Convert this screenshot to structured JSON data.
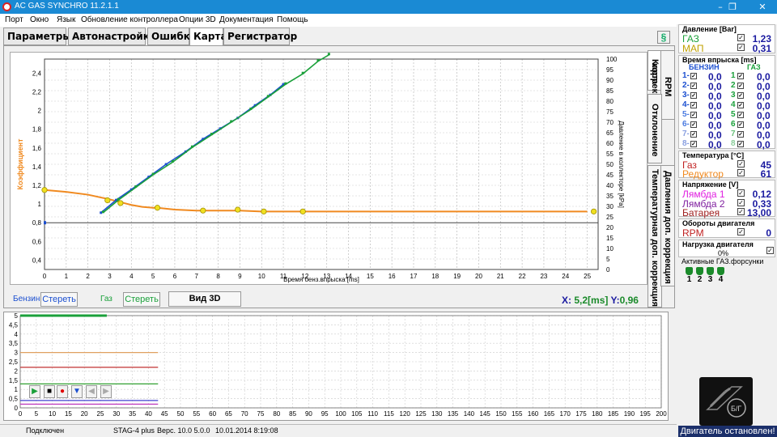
{
  "window": {
    "title": "AC GAS SYNCHRO  11.2.1.1",
    "minimize": "–",
    "maximize": "❐",
    "close": "✕"
  },
  "menu": [
    "Порт",
    "Окно",
    "Язык",
    "Обновление контроллера",
    "Опции 3D",
    "Документация",
    "Помощь"
  ],
  "tabs": [
    "Параметры",
    "Автонастройка",
    "Ошибки",
    "Карта",
    "Регистратор"
  ],
  "active_tab": "Карта",
  "help_icon": "help-icon",
  "side_tabs": [
    "Карта",
    "RPM коррекция",
    "Отклонение",
    "Температурная доп. коррекция",
    "Давления доп. коррекция"
  ],
  "controls": {
    "petrol_label": "Бензин",
    "petrol_clear": "Стереть",
    "gas_label": "Газ",
    "gas_clear": "Стереть",
    "view3d": "Вид 3D",
    "x_label": "X:",
    "x_value": "5,2[ms]",
    "y_label": "Y:",
    "y_value": "0,96"
  },
  "chart_data": {
    "type": "scatter",
    "xlabel": "Время бенз.впрыска [ms]",
    "ylabel_left": "Коэффициент",
    "ylabel_right": "Давление в коллекторе [kPa]",
    "x_ticks": [
      "0",
      "1",
      "2",
      "3",
      "4",
      "5",
      "6",
      "7",
      "8",
      "9",
      "10",
      "11",
      "12",
      "13",
      "14",
      "15",
      "16",
      "17",
      "18",
      "19",
      "20",
      "21",
      "22",
      "23",
      "24",
      "25"
    ],
    "y_ticks_left": [
      "0,4",
      "0,6",
      "0,8",
      "1",
      "1,2",
      "1,4",
      "1,6",
      "1,8",
      "2",
      "2,2",
      "2,4"
    ],
    "y_ticks_right": [
      "0",
      "5",
      "10",
      "15",
      "20",
      "25",
      "30",
      "35",
      "40",
      "45",
      "50",
      "55",
      "60",
      "65",
      "70",
      "75",
      "80",
      "85",
      "90",
      "95",
      "100"
    ],
    "xlim": [
      0,
      25.5
    ],
    "ylim_left": [
      0.3,
      2.55
    ],
    "ylim_right": [
      0,
      100
    ],
    "coefficient_curve": {
      "color": "#f08a20",
      "x": [
        0,
        1,
        2,
        3,
        3.5,
        4,
        4.5,
        5,
        5.2,
        6,
        7,
        7.3,
        8,
        9,
        10,
        11,
        11.9,
        13,
        15,
        20,
        25
      ],
      "y": [
        1.15,
        1.13,
        1.1,
        1.05,
        1.02,
        0.99,
        0.97,
        0.96,
        0.96,
        0.94,
        0.93,
        0.93,
        0.93,
        0.93,
        0.92,
        0.92,
        0.92,
        0.92,
        0.92,
        0.92,
        0.92
      ]
    },
    "coefficient_points": {
      "color": "#f0e020",
      "x": [
        0,
        2.9,
        3.5,
        5.2,
        7.3,
        8.9,
        10.1,
        11.9,
        25.3
      ],
      "y": [
        1.15,
        1.04,
        1.01,
        0.96,
        0.93,
        0.94,
        0.92,
        0.92,
        0.92
      ]
    },
    "petrol_series": {
      "name": "Бензин",
      "color": "#1b4fd0",
      "x": [
        2.6,
        3.3,
        4.0,
        4.8,
        5.6,
        6.5,
        7.3,
        8.1,
        8.9,
        9.7,
        10.4,
        11.0
      ],
      "y_kpa": [
        27,
        33,
        38,
        44,
        50,
        56,
        62,
        67,
        72,
        78,
        83,
        88
      ]
    },
    "gas_series": {
      "name": "Газ",
      "color": "#1aa03a",
      "x": [
        2.7,
        3.4,
        4.2,
        5.0,
        5.9,
        6.8,
        7.7,
        8.6,
        9.5,
        10.3,
        11.1,
        11.9,
        12.6,
        13.1
      ],
      "y_kpa": [
        27,
        33,
        39,
        45,
        51,
        58,
        64,
        70,
        76,
        82,
        88,
        93,
        99,
        102
      ]
    },
    "marker_line_y": 0.8
  },
  "lower_chart": {
    "y_ticks": [
      "0",
      "0,5",
      "1",
      "1,5",
      "2",
      "2,5",
      "3",
      "3,5",
      "4",
      "4,5",
      "5"
    ],
    "x_ticks": [
      "0",
      "5",
      "10",
      "15",
      "20",
      "25",
      "30",
      "35",
      "40",
      "45",
      "50",
      "55",
      "60",
      "65",
      "70",
      "75",
      "80",
      "85",
      "90",
      "95",
      "100",
      "105",
      "110",
      "115",
      "120",
      "125",
      "130",
      "135",
      "140",
      "145",
      "150",
      "155",
      "160",
      "165",
      "170",
      "175",
      "180",
      "185",
      "190",
      "195",
      "200"
    ],
    "traces": [
      {
        "color": "#1aa03a",
        "value": 5.0,
        "until": 27
      },
      {
        "color": "#e0a060",
        "value": 3.0,
        "until": 43
      },
      {
        "color": "#c03030",
        "value": 2.2,
        "until": 43
      },
      {
        "color": "#30a030",
        "value": 1.3,
        "until": 43
      },
      {
        "color": "#4040d0",
        "value": 0.4,
        "until": 43
      },
      {
        "color": "#c040c0",
        "value": 0.2,
        "until": 43
      }
    ]
  },
  "lower_controls": [
    "play-icon",
    "stop-icon",
    "record-icon",
    "save-icon",
    "prev-icon",
    "next-icon"
  ],
  "status": {
    "connection": "Подключен",
    "device": "STAG-4 plus",
    "version": "Верс. 10.0  5.0.0",
    "date": "10.01.2014 8:19:08"
  },
  "right": {
    "pressure": {
      "title": "Давление [Bar]",
      "rows": [
        {
          "name": "ГАЗ",
          "color": "#1aa03a",
          "value": "1,23"
        },
        {
          "name": "МАП",
          "color": "#c0a000",
          "value": "0,31"
        }
      ]
    },
    "injection": {
      "title": "Время впрыска [ms]",
      "petrol": "БЕНЗИН",
      "gas": "ГАЗ",
      "rows": [
        {
          "n": "1",
          "p": "0,0",
          "g": "0,0"
        },
        {
          "n": "2",
          "p": "0,0",
          "g": "0,0"
        },
        {
          "n": "3",
          "p": "0,0",
          "g": "0,0"
        },
        {
          "n": "4",
          "p": "0,0",
          "g": "0,0"
        },
        {
          "n": "5",
          "p": "0,0",
          "g": "0,0"
        },
        {
          "n": "6",
          "p": "0,0",
          "g": "0,0"
        },
        {
          "n": "7",
          "p": "0,0",
          "g": "0,0"
        },
        {
          "n": "8",
          "p": "0,0",
          "g": "0,0"
        }
      ]
    },
    "temperature": {
      "title": "Температура  [°C]",
      "rows": [
        {
          "name": "Газ",
          "color": "#c02020",
          "value": "45"
        },
        {
          "name": "Редуктор",
          "color": "#f08a20",
          "value": "61"
        }
      ]
    },
    "voltage": {
      "title": "Напряжение [V]",
      "rows": [
        {
          "name": "Лямбда 1",
          "color": "#e020e0",
          "value": "0,12"
        },
        {
          "name": "Лямбда 2",
          "color": "#8020a0",
          "value": "0,33"
        },
        {
          "name": "Батарея",
          "color": "#a02020",
          "value": "13,00"
        }
      ]
    },
    "rpm": {
      "title": "Обороты двигателя",
      "rows": [
        {
          "name": "RPM",
          "color": "#c02020",
          "value": "0"
        }
      ]
    },
    "load": {
      "title": "Нагрузка двигателя",
      "value": "0%"
    },
    "injectors": {
      "title": "Активные ГАЗ.форсунки",
      "labels": [
        "1",
        "2",
        "3",
        "4"
      ]
    },
    "engine_status": "Двигатель остановлен!"
  }
}
